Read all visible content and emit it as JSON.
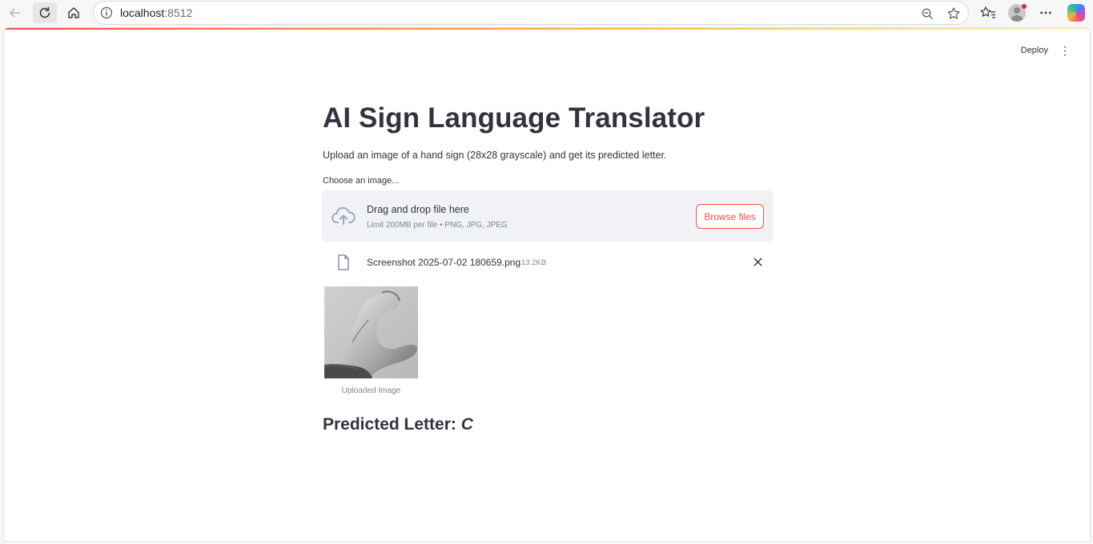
{
  "browser": {
    "url_host": "localhost",
    "url_port": ":8512"
  },
  "toolbar": {
    "deploy_label": "Deploy",
    "menu_icon": "⋮"
  },
  "app": {
    "title": "AI Sign Language Translator",
    "description": "Upload an image of a hand sign (28x28 grayscale) and get its predicted letter.",
    "uploader": {
      "label": "Choose an image...",
      "drop_title": "Drag and drop file here",
      "drop_limit": "Limit 200MB per file • PNG, JPG, JPEG",
      "browse_label": "Browse files"
    },
    "file": {
      "name": "Screenshot 2025-07-02 180659.png",
      "size": "13.2KB"
    },
    "image_caption": "Uploaded Image",
    "prediction_prefix": "Predicted Letter: ",
    "prediction_letter": "C"
  },
  "colors": {
    "primary": "#ff4b4b",
    "text": "#31333f",
    "muted": "#808495",
    "dropzone_bg": "#f0f2f6"
  }
}
